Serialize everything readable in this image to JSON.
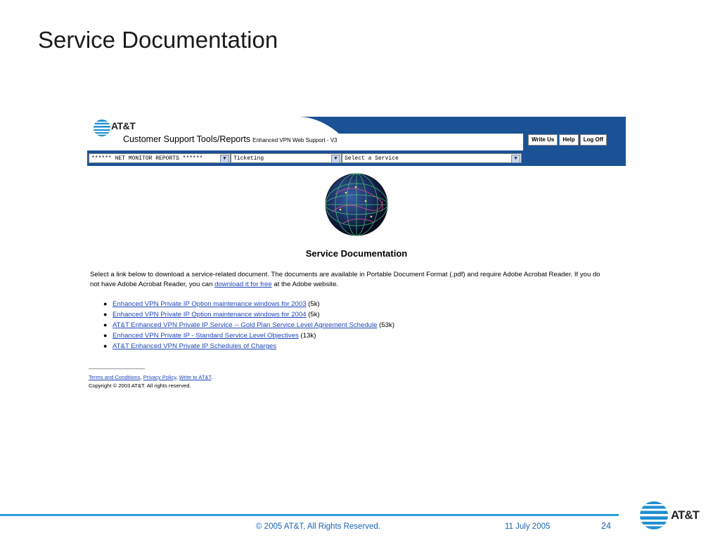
{
  "slide": {
    "title": "Service Documentation",
    "footer_copyright": "© 2005 AT&T, All Rights Reserved.",
    "footer_date": "11 July 2005",
    "page_number": "24",
    "logo_text": "AT&T"
  },
  "webpage": {
    "brand": "AT&T",
    "tools_title": "Customer Support Tools/Reports",
    "tools_subtitle": "Enhanced VPN Web Support - V3",
    "buttons": {
      "write_us": "Write Us",
      "help": "Help",
      "log_off": "Log Off"
    },
    "selects": {
      "reports": "****** NET MONITOR REPORTS ******",
      "ticketing": "Ticketing",
      "service": "Select a Service"
    },
    "heading": "Service Documentation",
    "intro_before": "Select a link below to download a service-related document. The documents are available in Portable Document Format (.pdf) and require Adobe Acrobat Reader. If you do not have Adobe Acrobat Reader, you can ",
    "intro_link": "download it for free",
    "intro_after": " at the Adobe website.",
    "documents": [
      {
        "title": "Enhanced VPN Private IP Option maintenance windows for 2003",
        "size": " (5k)"
      },
      {
        "title": "Enhanced VPN Private IP Option maintenance windows for 2004",
        "size": " (5k)"
      },
      {
        "title": "AT&T Enhanced VPN Private IP Service -- Gold Plan Service Level Agreement Schedule",
        "size": " (53k)"
      },
      {
        "title": "Enhanced VPN Private IP - Standard Service Level Objectives",
        "size": " (13k)"
      },
      {
        "title": "AT&T Enhanced VPN Private IP Schedules of Charges",
        "size": ""
      }
    ],
    "footer": {
      "terms": "Terms and Conditions",
      "privacy": "Privacy Policy",
      "write": "Write to AT&T",
      "sep": ", ",
      "end": ".",
      "copyright": "Copyright © 2003 AT&T. All rights reserved."
    }
  },
  "colors": {
    "header_blue": "#1b5296",
    "link": "#1f45b8",
    "slide_accent": "#2aa0d8"
  }
}
